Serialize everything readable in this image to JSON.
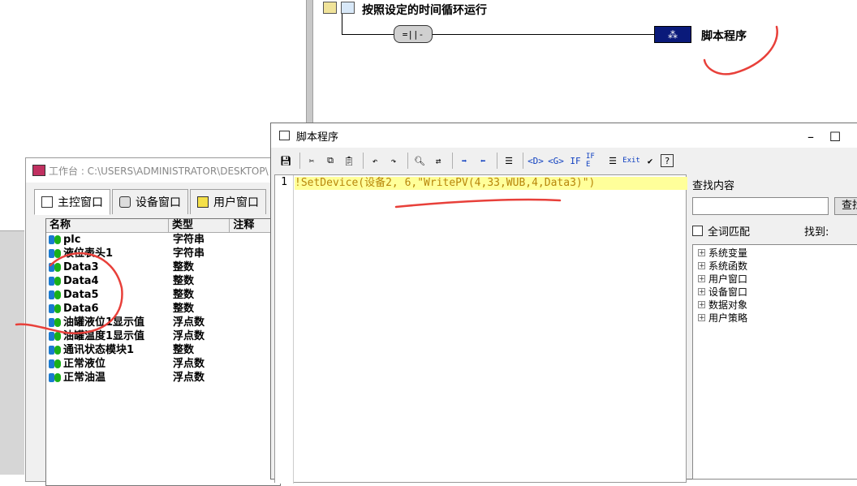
{
  "strategy": {
    "title": "按照设定的时间循环运行",
    "condition_symbol": "=||-",
    "script_label": "脚本程序"
  },
  "workbench": {
    "title": "工作台 : C:\\USERS\\ADMINISTRATOR\\DESKTOP\\",
    "tabs": [
      {
        "label": "主控窗口"
      },
      {
        "label": "设备窗口"
      },
      {
        "label": "用户窗口"
      }
    ],
    "columns": {
      "name": "名称",
      "type": "类型",
      "note": "注释"
    },
    "rows": [
      {
        "name": "plc",
        "type": "字符串"
      },
      {
        "name": "液位表头1",
        "type": "字符串"
      },
      {
        "name": "Data3",
        "type": "整数"
      },
      {
        "name": "Data4",
        "type": "整数"
      },
      {
        "name": "Data5",
        "type": "整数"
      },
      {
        "name": "Data6",
        "type": "整数"
      },
      {
        "name": "油罐液位1显示值",
        "type": "浮点数"
      },
      {
        "name": "油罐温度1显示值",
        "type": "浮点数"
      },
      {
        "name": "通讯状态模块1",
        "type": "整数"
      },
      {
        "name": "正常液位",
        "type": "浮点数"
      },
      {
        "name": "正常油温",
        "type": "浮点数"
      }
    ]
  },
  "script_window": {
    "title": "脚本程序",
    "maximize_glyph": "☐",
    "toolbar": [
      "save-icon",
      "cut-icon",
      "copy-icon",
      "paste-icon",
      "undo-icon",
      "redo-icon",
      "find-icon",
      "replace-icon",
      "indent-icon",
      "outdent-icon",
      "comment-icon",
      "func-d-icon",
      "func-g-icon",
      "if-icon",
      "if-else-icon",
      "while-icon",
      "exit-icon",
      "check-icon",
      "help-icon"
    ],
    "toolbar_labels": {
      "d": "<D>",
      "g": "<G>",
      "if": "IF",
      "ife": "IF E",
      "exit": "Exit"
    },
    "line_number": "1",
    "code_line": "!SetDevice(设备2, 6,\"WritePV(4,33,WUB,4,Data3)\")",
    "find_label": "查找内容",
    "find_button": "查找",
    "whole_word": "全词匹配",
    "found_label": "找到:",
    "tree": [
      "系统变量",
      "系统函数",
      "用户窗口",
      "设备窗口",
      "数据对象",
      "用户策略"
    ]
  },
  "colors": {
    "annotation": "#e8403a",
    "highlight": "#ffff9a",
    "script_block": "#0a1a7a"
  }
}
